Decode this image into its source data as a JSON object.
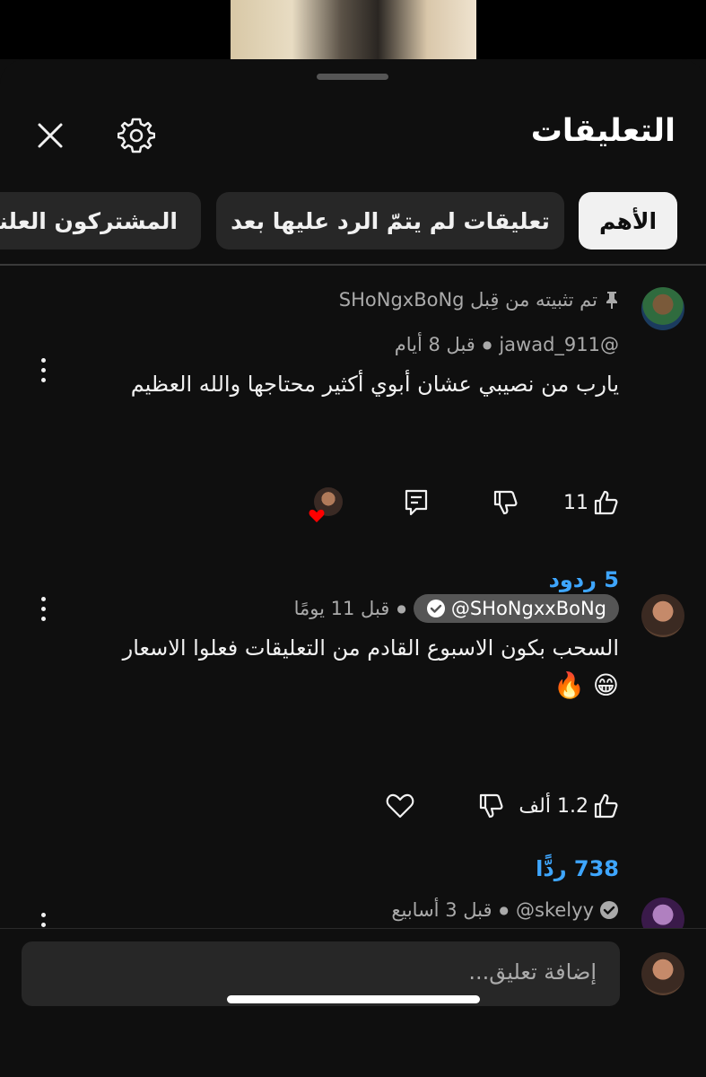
{
  "header": {
    "title": "التعليقات"
  },
  "filters": [
    {
      "label": "الأهم",
      "active": true
    },
    {
      "label": "تعليقات لم يتمّ الرد عليها بعد",
      "active": false
    },
    {
      "label": "المشتركون العلنيو",
      "active": false
    }
  ],
  "comments": [
    {
      "pinned_label": "تم تثبيته من قِبل SHoNgxBoNg",
      "author": "@jawad_911",
      "time": "قبل 8 أيام",
      "text": "يارب من نصيبي عشان أبوي أكثير محتاجها والله العظيم",
      "likes": "11",
      "replies": "5 ردود",
      "creator_heart": true
    },
    {
      "author": "@SHoNgxxBoNg",
      "verified": true,
      "time": "قبل 11 يومًا",
      "text_line1": "السحب بكون الاسبوع القادم من التعليقات فعلوا الاسعار",
      "emoji": "😁 🔥",
      "likes": "1.2 ألف",
      "replies": "738 ردًّا"
    },
    {
      "author": "@skelyy",
      "verified": true,
      "time": "قبل 3 أسابيع"
    }
  ],
  "composer": {
    "placeholder": "إضافة تعليق..."
  },
  "colors": {
    "background": "#0f0f0f",
    "chip": "#272727",
    "link": "#3ea6ff",
    "heart": "#ff0000"
  }
}
